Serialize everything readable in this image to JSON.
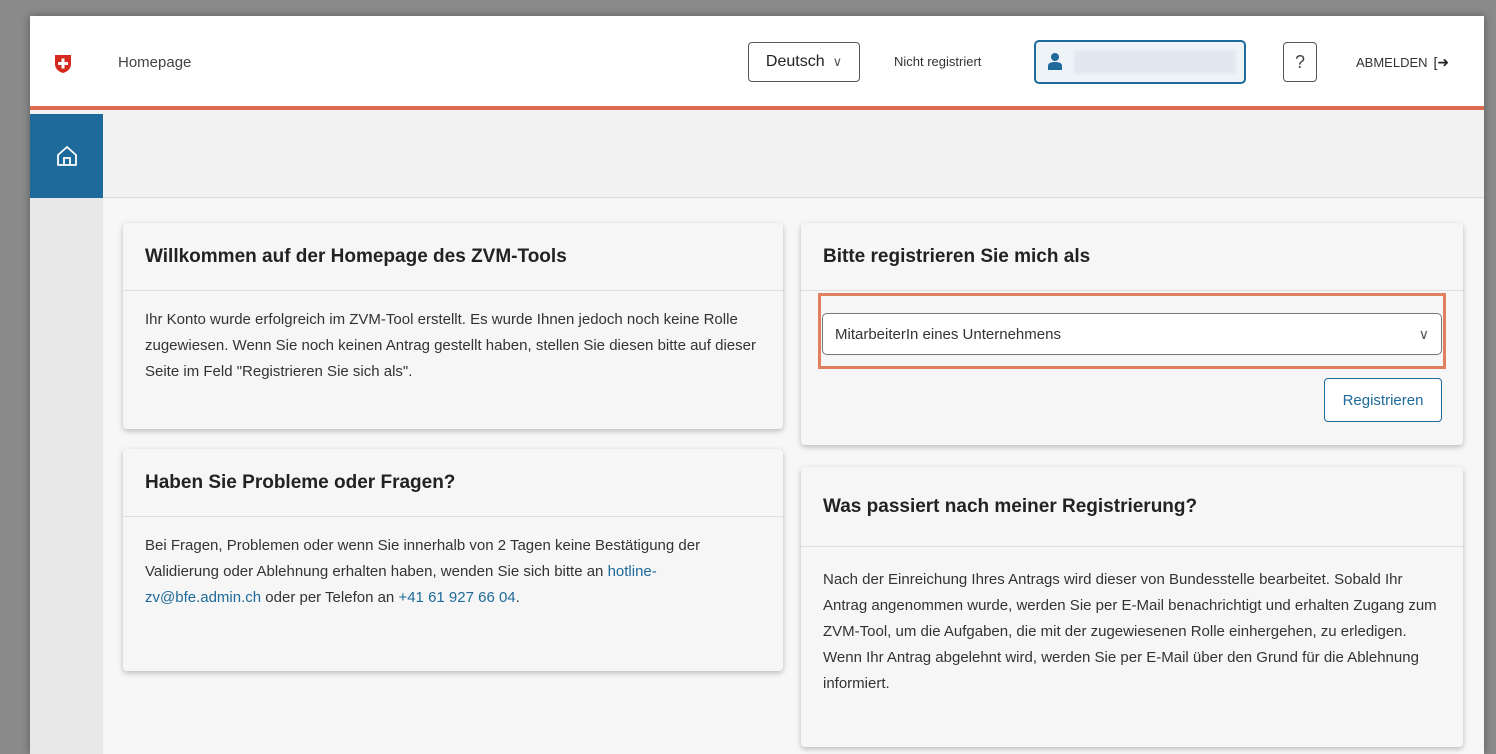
{
  "header": {
    "app_title": "Homepage",
    "language": "Deutsch",
    "registration_status": "Nicht registriert",
    "help_label": "?",
    "logout_label": "ABMELDEN"
  },
  "welcome_card": {
    "title": "Willkommen auf der Homepage des ZVM-Tools",
    "text": "Ihr Konto wurde erfolgreich im ZVM-Tool erstellt. Es wurde Ihnen jedoch noch keine Rolle zugewiesen. Wenn Sie noch keinen Antrag gestellt haben, stellen Sie diesen bitte auf dieser Seite im Feld \"Registrieren Sie sich als\"."
  },
  "help_card": {
    "title": "Haben Sie Probleme oder Fragen?",
    "text_before": "Bei Fragen, Problemen oder wenn Sie innerhalb von 2 Tagen keine Bestätigung der Validierung oder Ablehnung erhalten haben, wenden Sie sich bitte an ",
    "email": "hotline-zv@bfe.admin.ch",
    "text_middle": " oder per Telefon an ",
    "phone": "+41 61 927 66 04",
    "text_after": "."
  },
  "register_card": {
    "title": "Bitte registrieren Sie mich als",
    "selected_role": "MitarbeiterIn eines Unternehmens",
    "register_button": "Registrieren"
  },
  "after_card": {
    "title": "Was passiert nach meiner Registrierung?",
    "text": "Nach der Einreichung Ihres Antrags wird dieser von Bundesstelle bearbeitet. Sobald Ihr Antrag angenommen wurde, werden Sie per E-Mail benachrichtigt und erhalten Zugang zum ZVM-Tool, um die Aufgaben, die mit der zugewiesenen Rolle einhergehen, zu erledigen. Wenn Ihr Antrag abgelehnt wird, werden Sie per E-Mail über den Grund für die Ablehnung informiert."
  },
  "colors": {
    "accent_red": "#dc6b4f",
    "primary_blue": "#1e6a9a",
    "highlight_orange": "#e0805f"
  },
  "icons": {
    "logo": "swiss-cross-icon",
    "user": "user-icon",
    "home": "home-icon",
    "logout": "logout-icon",
    "chevron": "chevron-down-icon"
  }
}
